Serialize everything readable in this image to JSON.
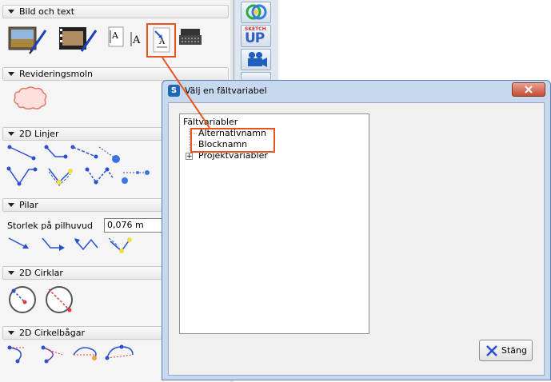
{
  "palette": {
    "sections": {
      "bild_och_text": "Bild och text",
      "revideringsmoln": "Revideringsmoln",
      "linjer_2d": "2D Linjer",
      "pilar": "Pilar",
      "cirklar_2d": "2D Cirklar",
      "cirkelbagar_2d": "2D Cirkelbågar"
    },
    "arrow_size_label": "Storlek på pilhuvud",
    "arrow_size_value": "0,076 m"
  },
  "toolbar": {
    "sketchup_top": "SKETCH",
    "sketchup_bottom": "UP"
  },
  "dialog": {
    "title": "Välj en fältvariabel",
    "logo_letter": "S",
    "tree": {
      "root": "Fältvariabler",
      "child1": "Alternativnamn",
      "child2": "Blocknamn",
      "project": "Projektvariabler",
      "expand_symbol": "+"
    },
    "close_button": "Stäng"
  },
  "colors": {
    "highlight": "#e8541e",
    "dialog_frame": "#c6d9ef",
    "accent_blue": "#2a4fcf"
  }
}
